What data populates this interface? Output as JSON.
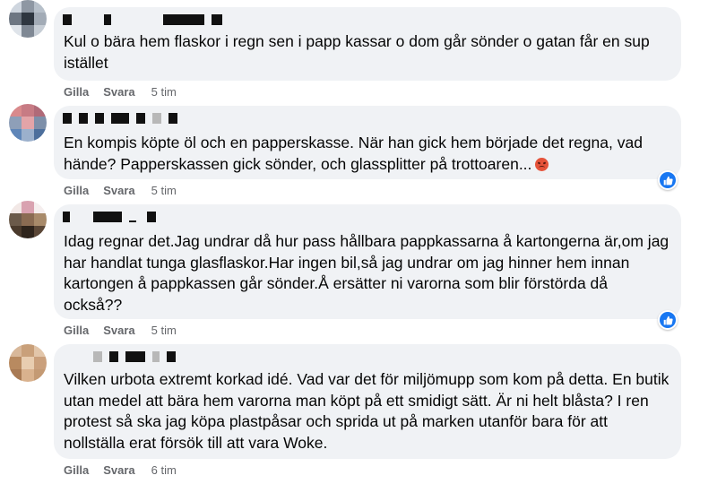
{
  "colors": {
    "bubble_bg": "#f0f2f5",
    "meta_text": "#65676b",
    "like_blue": "#1877f2",
    "angry_react": "#e5533a"
  },
  "comments": [
    {
      "text": "Kul o bära hem flaskor i regn sen i papp kassar o dom går sönder o gatan får en sup istället",
      "like_label": "Gilla",
      "reply_label": "Svara",
      "time": "5 tim"
    },
    {
      "text": "En kompis köpte öl och en papperskasse. När han gick hem började det regna, vad hände? Papperskassen gick sönder, och glassplitter på trottoaren...",
      "reaction_icon": "angry-face-emoji",
      "like_label": "Gilla",
      "reply_label": "Svara",
      "time": "5 tim",
      "reaction_badge": "like-icon"
    },
    {
      "text": "Idag regnar det.Jag undrar då hur pass hållbara pappkassarna å kartongerna är,om jag har handlat tunga glasflaskor.Har ingen bil,så jag undrar om jag hinner hem innan kartongen å pappkassen går sönder.Å ersätter ni varorna som blir förstörda då också??",
      "like_label": "Gilla",
      "reply_label": "Svara",
      "time": "5 tim",
      "reaction_badge": "like-icon"
    },
    {
      "text": "Vilken urbota extremt korkad idé. Vad var det för miljömupp som kom på detta. En butik utan medel att bära hem varorna man köpt på ett smidigt sätt. Är ni helt blåsta? I ren protest så ska jag köpa plastpåsar och sprida ut på marken utanför bara för att nollställa erat försök till att vara Woke.",
      "like_label": "Gilla",
      "reply_label": "Svara",
      "time": "6 tim"
    }
  ]
}
